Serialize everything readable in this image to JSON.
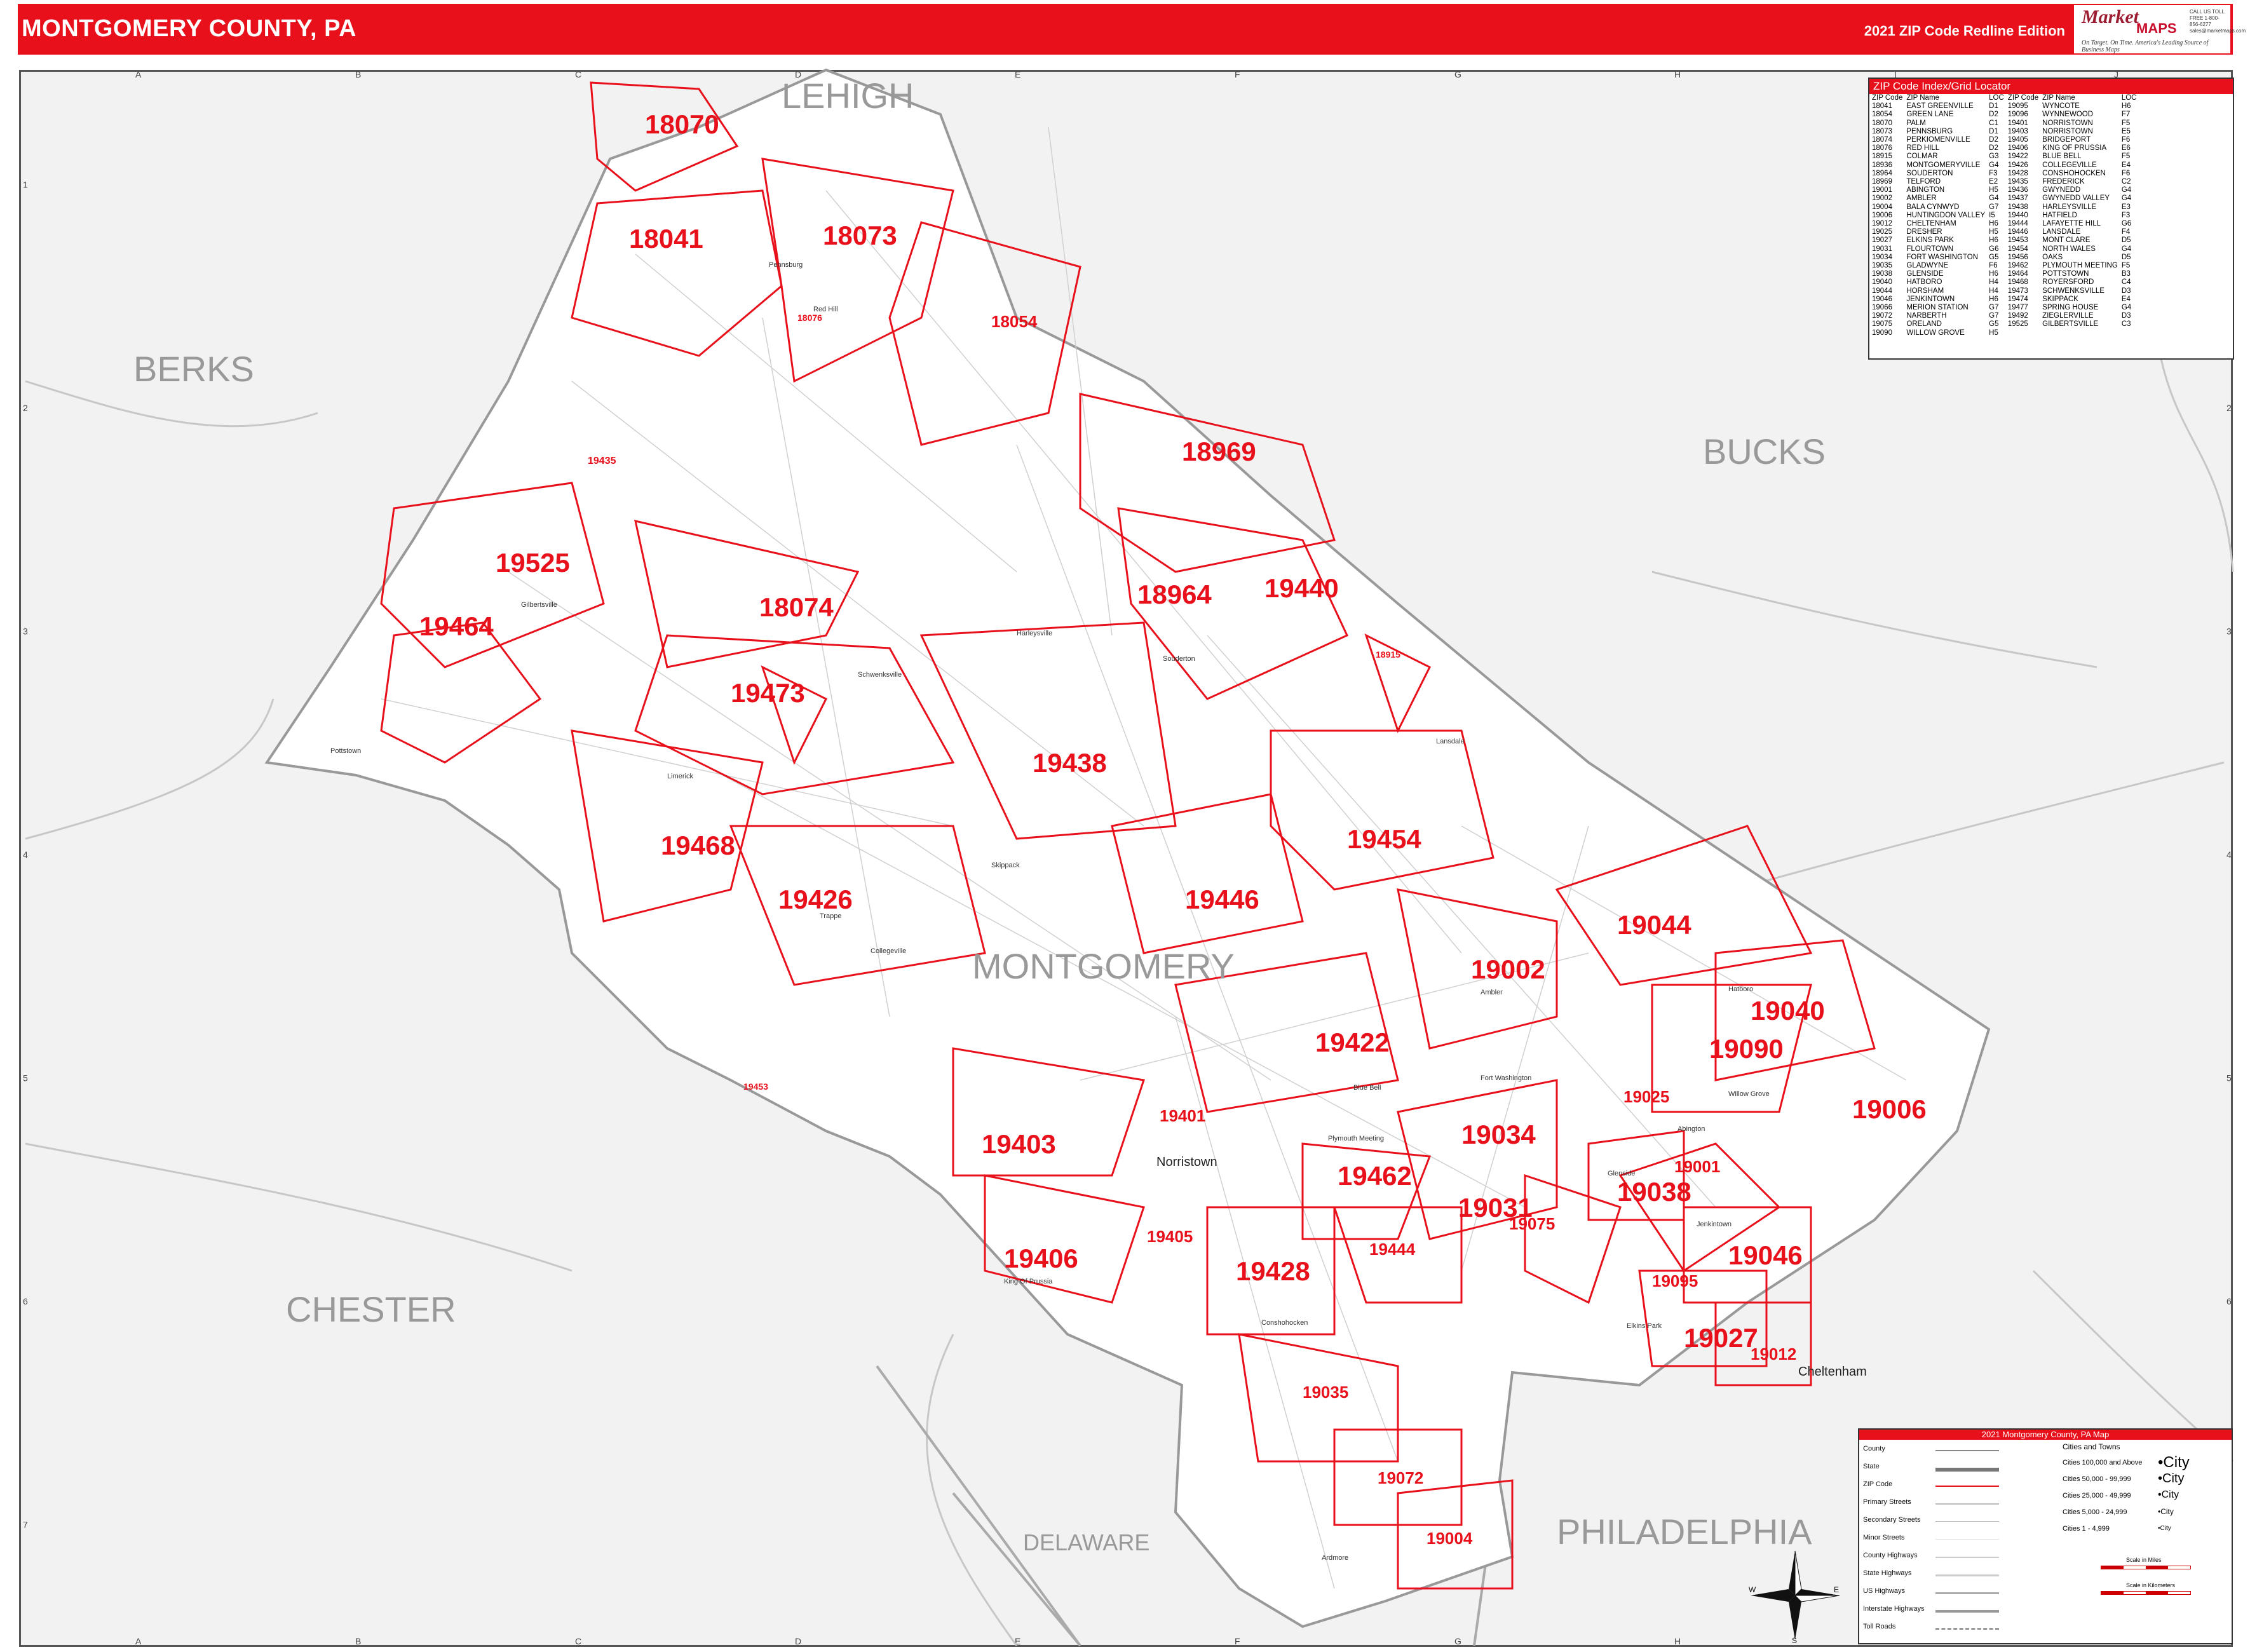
{
  "header": {
    "title": "MONTGOMERY COUNTY, PA",
    "edition": "2021 ZIP Code Redline Edition",
    "logo_brand": "Market",
    "logo_maps": "MAPS",
    "logo_tagline": "On Target. On Time. America's Leading Source of Business Maps",
    "logo_contact": "CALL US TOLL FREE 1-800-856-6277 sales@marketmaps.com"
  },
  "grid": {
    "columns": [
      "A",
      "B",
      "C",
      "D",
      "E",
      "F",
      "G",
      "H",
      "I",
      "J"
    ],
    "rows": [
      "1",
      "2",
      "3",
      "4",
      "5",
      "6",
      "7"
    ]
  },
  "counties": {
    "lehigh": "LEHIGH",
    "berks": "BERKS",
    "bucks": "BUCKS",
    "chester": "CHESTER",
    "montgomery": "MONTGOMERY",
    "delaware": "DELAWARE",
    "philadelphia": "PHILADELPHIA"
  },
  "zip_labels": [
    "18070",
    "18041",
    "18073",
    "18054",
    "18969",
    "19525",
    "19464",
    "18074",
    "18964",
    "19440",
    "19473",
    "19438",
    "19468",
    "19454",
    "19426",
    "19446",
    "19044",
    "19002",
    "19040",
    "19090",
    "19422",
    "19006",
    "19401",
    "19403",
    "19034",
    "19025",
    "19462",
    "19001",
    "19038",
    "19031",
    "19075",
    "19406",
    "19405",
    "19428",
    "19444",
    "19046",
    "19095",
    "19027",
    "19012",
    "19035",
    "19072",
    "19004",
    "19435",
    "18076",
    "18915",
    "19453"
  ],
  "towns": {
    "norristown": "Norristown",
    "cheltenham": "Cheltenham",
    "pottstown": "Pottstown",
    "king_of_prussia": "King Of Prussia",
    "lansdale": "Lansdale",
    "souderton": "Souderton",
    "pennsburg": "Pennsburg",
    "collegeville": "Collegeville",
    "ambler": "Ambler",
    "conshohocken": "Conshohocken",
    "harleysville": "Harleysville",
    "red_hill": "Red Hill",
    "schwenksville": "Schwenksville",
    "blue_bell": "Blue Bell",
    "willow_grove": "Willow Grove",
    "abington": "Abington",
    "jenkintown": "Jenkintown",
    "hatboro": "Hatboro",
    "ardmore": "Ardmore",
    "plymouth_meeting": "Plymouth Meeting",
    "fort_washington": "Fort Washington",
    "glenside": "Glenside",
    "elkins_park": "Elkins Park",
    "gilbertsville": "Gilbertsville",
    "trappe": "Trappe",
    "limerick": "Limerick",
    "skippack": "Skippack"
  },
  "index": {
    "title": "ZIP Code Index/Grid Locator",
    "headers": [
      "ZIP Code",
      "ZIP Name",
      "LOC",
      "ZIP Code",
      "ZIP Name",
      "LOC"
    ],
    "rows": [
      [
        "18041",
        "EAST GREENVILLE",
        "D1",
        "19095",
        "WYNCOTE",
        "H6"
      ],
      [
        "18054",
        "GREEN LANE",
        "D2",
        "19096",
        "WYNNEWOOD",
        "F7"
      ],
      [
        "18070",
        "PALM",
        "C1",
        "19401",
        "NORRISTOWN",
        "F5"
      ],
      [
        "18073",
        "PENNSBURG",
        "D1",
        "19403",
        "NORRISTOWN",
        "E5"
      ],
      [
        "18074",
        "PERKIOMENVILLE",
        "D2",
        "19405",
        "BRIDGEPORT",
        "F6"
      ],
      [
        "18076",
        "RED HILL",
        "D2",
        "19406",
        "KING OF PRUSSIA",
        "E6"
      ],
      [
        "18915",
        "COLMAR",
        "G3",
        "19422",
        "BLUE BELL",
        "F5"
      ],
      [
        "18936",
        "MONTGOMERYVILLE",
        "G4",
        "19426",
        "COLLEGEVILLE",
        "E4"
      ],
      [
        "18964",
        "SOUDERTON",
        "F3",
        "19428",
        "CONSHOHOCKEN",
        "F6"
      ],
      [
        "18969",
        "TELFORD",
        "E2",
        "19435",
        "FREDERICK",
        "C2"
      ],
      [
        "19001",
        "ABINGTON",
        "H5",
        "19436",
        "GWYNEDD",
        "G4"
      ],
      [
        "19002",
        "AMBLER",
        "G4",
        "19437",
        "GWYNEDD VALLEY",
        "G4"
      ],
      [
        "19004",
        "BALA CYNWYD",
        "G7",
        "19438",
        "HARLEYSVILLE",
        "E3"
      ],
      [
        "19006",
        "HUNTINGDON VALLEY",
        "I5",
        "19440",
        "HATFIELD",
        "F3"
      ],
      [
        "19012",
        "CHELTENHAM",
        "H6",
        "19444",
        "LAFAYETTE HILL",
        "G6"
      ],
      [
        "19025",
        "DRESHER",
        "H5",
        "19446",
        "LANSDALE",
        "F4"
      ],
      [
        "19027",
        "ELKINS PARK",
        "H6",
        "19453",
        "MONT CLARE",
        "D5"
      ],
      [
        "19031",
        "FLOURTOWN",
        "G6",
        "19454",
        "NORTH WALES",
        "G4"
      ],
      [
        "19034",
        "FORT WASHINGTON",
        "G5",
        "19456",
        "OAKS",
        "D5"
      ],
      [
        "19035",
        "GLADWYNE",
        "F6",
        "19462",
        "PLYMOUTH MEETING",
        "F5"
      ],
      [
        "19038",
        "GLENSIDE",
        "H6",
        "19464",
        "POTTSTOWN",
        "B3"
      ],
      [
        "19040",
        "HATBORO",
        "H4",
        "19468",
        "ROYERSFORD",
        "C4"
      ],
      [
        "19044",
        "HORSHAM",
        "H4",
        "19473",
        "SCHWENKSVILLE",
        "D3"
      ],
      [
        "19046",
        "JENKINTOWN",
        "H6",
        "19474",
        "SKIPPACK",
        "E4"
      ],
      [
        "19066",
        "MERION STATION",
        "G7",
        "19477",
        "SPRING HOUSE",
        "G4"
      ],
      [
        "19072",
        "NARBERTH",
        "G7",
        "19492",
        "ZIEGLERVILLE",
        "D3"
      ],
      [
        "19075",
        "ORELAND",
        "G5",
        "19525",
        "GILBERTSVILLE",
        "C3"
      ],
      [
        "19090",
        "WILLOW GROVE",
        "H5",
        "",
        "",
        ""
      ]
    ]
  },
  "legend": {
    "title": "2021 Montgomery County, PA Map",
    "items": [
      "County",
      "State",
      "ZIP Code",
      "Primary Streets",
      "Secondary Streets",
      "Minor Streets",
      "County Highways",
      "State Highways",
      "US Highways",
      "Interstate Highways",
      "Toll Roads"
    ],
    "cities_title": "Cities and Towns",
    "cities": [
      {
        "label": "Cities 100,000 and Above",
        "sample": "•City"
      },
      {
        "label": "Cities 50,000 - 99,999",
        "sample": "•City"
      },
      {
        "label": "Cities 25,000 - 49,999",
        "sample": "•City"
      },
      {
        "label": "Cities 5,000 - 24,999",
        "sample": "•City"
      },
      {
        "label": "Cities 1 - 4,999",
        "sample": "•City"
      }
    ],
    "scale_miles": "Scale in Miles",
    "scale_km": "Scale in Kilometers"
  },
  "compass": {
    "n": "N",
    "s": "S",
    "e": "E",
    "w": "W"
  },
  "colors": {
    "accent": "#e8101a",
    "county_fill": "#ffffff",
    "outside_fill": "#f2f2f2",
    "road": "#bdbdbd",
    "county_label": "#999999"
  }
}
